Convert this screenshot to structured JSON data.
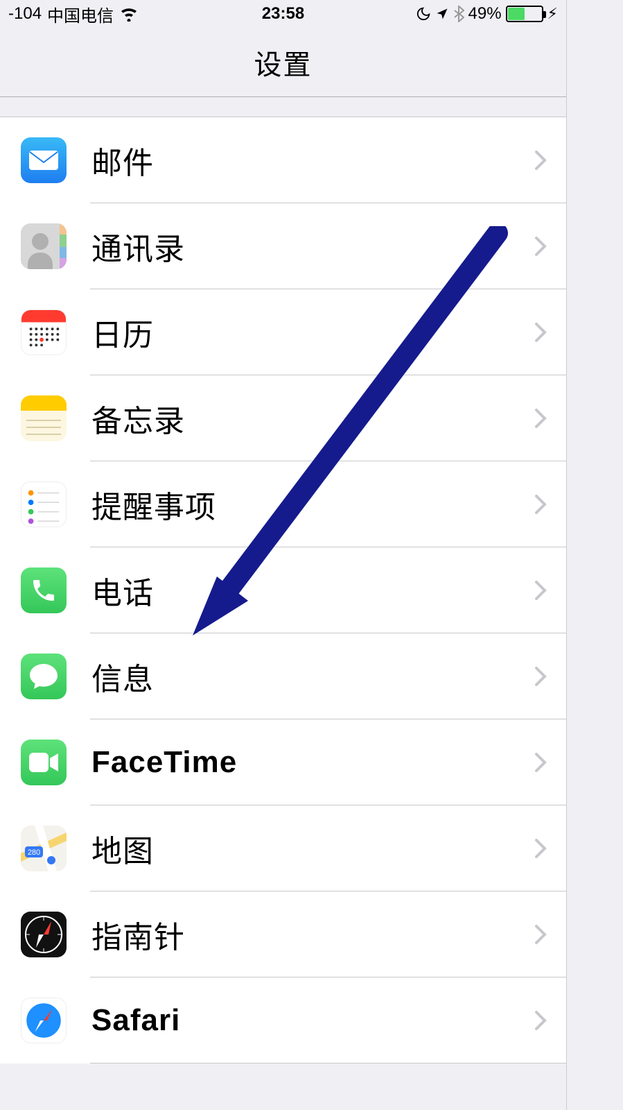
{
  "status": {
    "signal": "-104",
    "carrier": "中国电信",
    "time": "23:58",
    "battery_percent": "49%"
  },
  "navbar": {
    "title": "设置"
  },
  "rows": [
    {
      "label": "邮件"
    },
    {
      "label": "通讯录"
    },
    {
      "label": "日历"
    },
    {
      "label": "备忘录"
    },
    {
      "label": "提醒事项"
    },
    {
      "label": "电话"
    },
    {
      "label": "信息"
    },
    {
      "label": "FaceTime"
    },
    {
      "label": "地图"
    },
    {
      "label": "指南针"
    },
    {
      "label": "Safari"
    }
  ]
}
